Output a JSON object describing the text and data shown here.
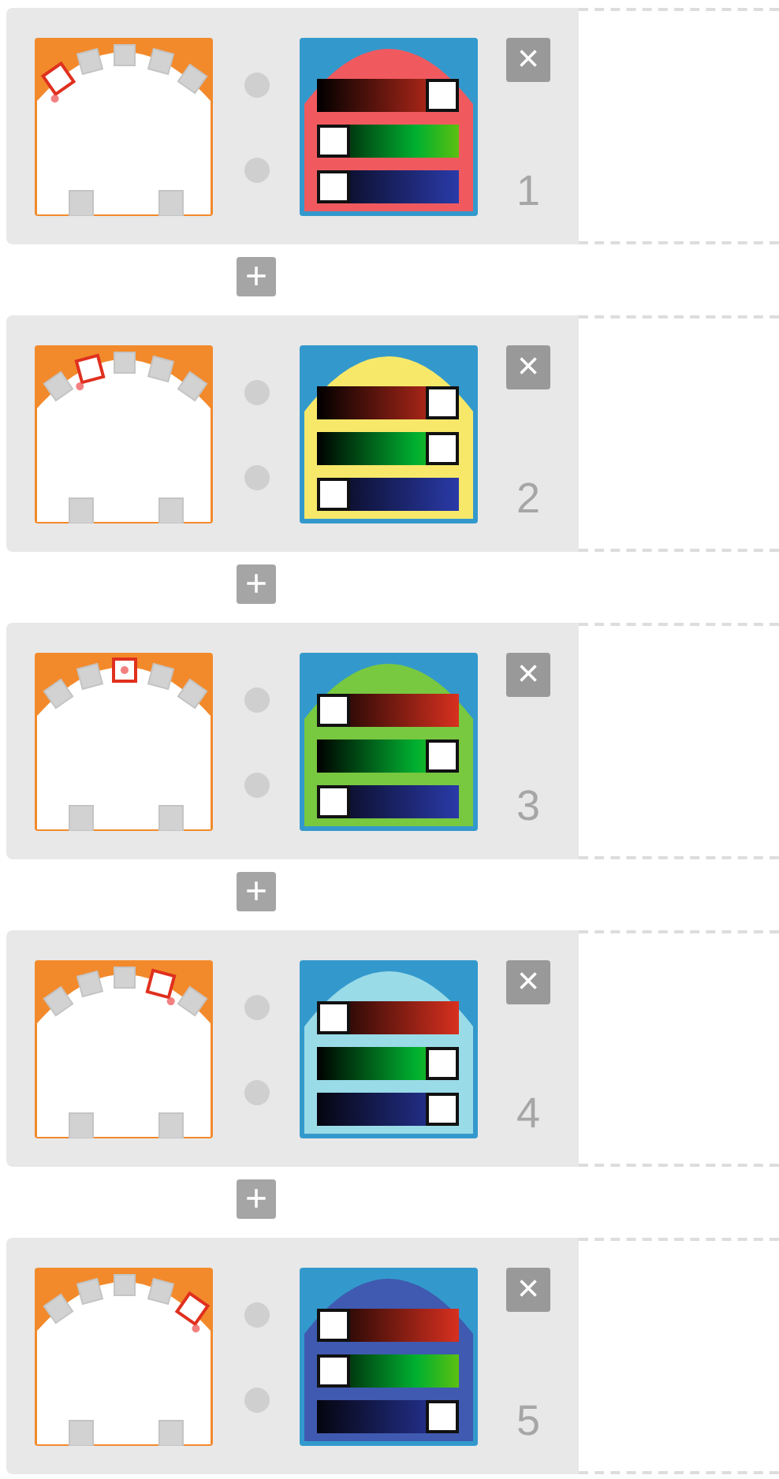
{
  "steps": [
    {
      "number": "1",
      "close": "×",
      "leds": [
        {
          "selected": true
        },
        {
          "selected": false
        },
        {
          "selected": false
        },
        {
          "selected": false
        },
        {
          "selected": false
        }
      ],
      "color": "#f05a5f",
      "channels": [
        {
          "level": 1
        },
        {
          "level": 0
        },
        {
          "level": 0
        }
      ]
    },
    {
      "number": "2",
      "close": "×",
      "leds": [
        {
          "selected": false
        },
        {
          "selected": true
        },
        {
          "selected": false
        },
        {
          "selected": false
        },
        {
          "selected": false
        }
      ],
      "color": "#f7e86a",
      "channels": [
        {
          "level": 1
        },
        {
          "level": 1
        },
        {
          "level": 0
        }
      ]
    },
    {
      "number": "3",
      "close": "×",
      "leds": [
        {
          "selected": false
        },
        {
          "selected": false
        },
        {
          "selected": true
        },
        {
          "selected": false
        },
        {
          "selected": false
        }
      ],
      "color": "#78c840",
      "channels": [
        {
          "level": 0
        },
        {
          "level": 1
        },
        {
          "level": 0
        }
      ]
    },
    {
      "number": "4",
      "close": "×",
      "leds": [
        {
          "selected": false
        },
        {
          "selected": false
        },
        {
          "selected": false
        },
        {
          "selected": true
        },
        {
          "selected": false
        }
      ],
      "color": "#9adbe8",
      "channels": [
        {
          "level": 0
        },
        {
          "level": 1
        },
        {
          "level": 1
        }
      ]
    },
    {
      "number": "5",
      "close": "×",
      "leds": [
        {
          "selected": false
        },
        {
          "selected": false
        },
        {
          "selected": false
        },
        {
          "selected": false
        },
        {
          "selected": true
        }
      ],
      "color": "#3f5ab0",
      "channels": [
        {
          "level": 0
        },
        {
          "level": 0
        },
        {
          "level": 1
        }
      ]
    }
  ],
  "add_buttons": [
    "+",
    "+",
    "+",
    "+"
  ]
}
